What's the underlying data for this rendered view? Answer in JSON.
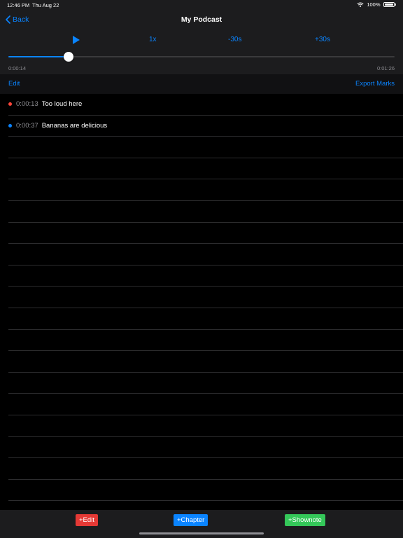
{
  "status_bar": {
    "time": "12:46 PM",
    "date": "Thu Aug 22",
    "battery": "100%"
  },
  "nav": {
    "back_label": "Back",
    "title": "My Podcast"
  },
  "controls": {
    "speed_label": "1x",
    "back30_label": "-30s",
    "fwd30_label": "+30s"
  },
  "playback": {
    "elapsed": "0:00:14",
    "total": "0:01:26",
    "progress_fraction": 0.155
  },
  "edit_bar": {
    "edit_label": "Edit",
    "export_label": "Export Marks"
  },
  "marks": [
    {
      "time": "0:00:13",
      "text": "Too loud here",
      "color": "#ff453a"
    },
    {
      "time": "0:00:37",
      "text": "Bananas are delicious",
      "color": "#0a84ff"
    }
  ],
  "actions": {
    "edit_label": "+Edit",
    "chapter_label": "+Chapter",
    "shownote_label": "+Shownote"
  },
  "colors": {
    "accent": "#0a84ff",
    "edit_red": "#e53935",
    "shownote_green": "#34c759"
  }
}
